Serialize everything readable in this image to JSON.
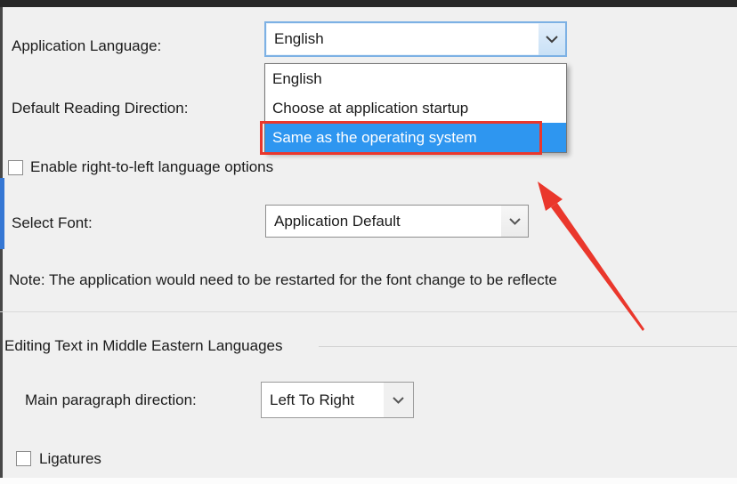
{
  "colors": {
    "highlight_blue": "#2e96f0",
    "annotation_red": "#ea372c",
    "focus_border_blue": "#7db1e4",
    "indicator_blue": "#3577d4",
    "topbar_dark": "#282828"
  },
  "icons": {
    "dropdown_chevron": "chevron-down"
  },
  "language_row": {
    "label": "Application Language:",
    "value": "English"
  },
  "language_dropdown": {
    "options": [
      "English",
      "Choose at application startup",
      "Same as the operating system"
    ],
    "highlighted_option": "Same as the operating system"
  },
  "reading_direction_row": {
    "label": "Default Reading Direction:"
  },
  "rtl_checkbox": {
    "label": "Enable right-to-left language options",
    "checked": false
  },
  "font_row": {
    "label": "Select Font:",
    "value": "Application Default"
  },
  "note_text": "Note: The application would need to be restarted for the font change to be reflecte",
  "group_section": {
    "title": "Editing Text in Middle Eastern Languages"
  },
  "paragraph_direction_row": {
    "label": "Main paragraph direction:",
    "value": "Left To Right"
  },
  "ligatures_checkbox": {
    "label": "Ligatures",
    "checked": false
  }
}
